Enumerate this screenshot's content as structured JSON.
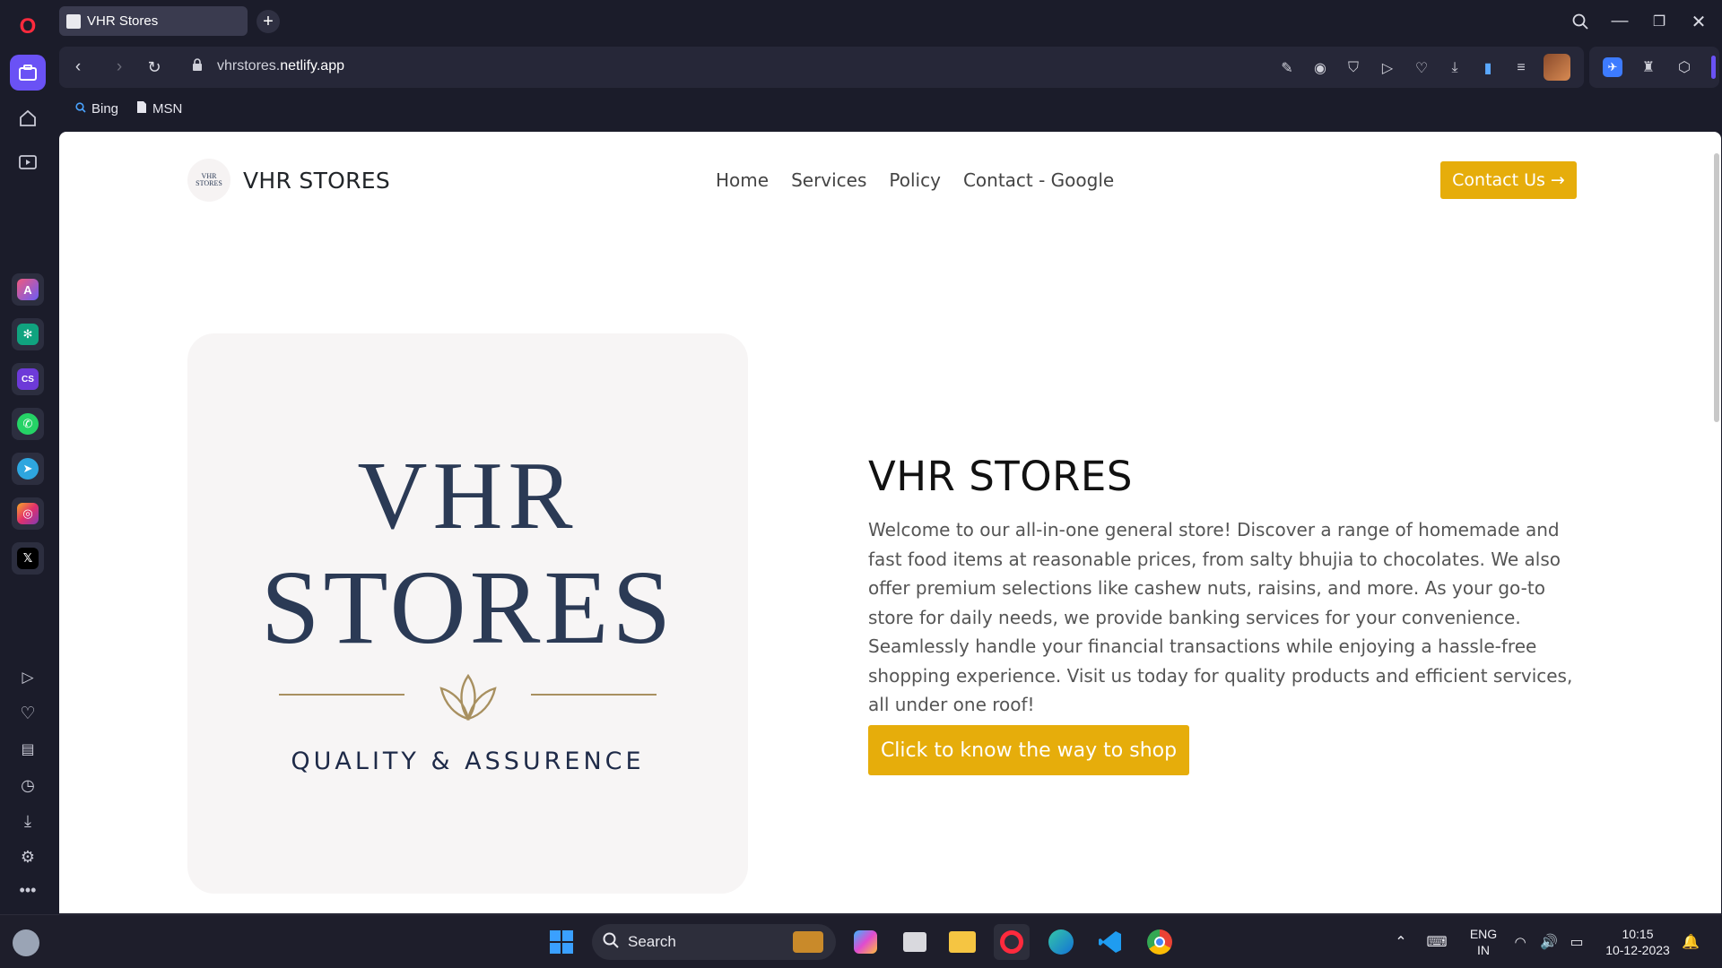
{
  "browser": {
    "tab_title": "VHR Stores",
    "url_prefix": "vhrstores.",
    "url_domain": "netlify.app",
    "bookmarks": [
      {
        "label": "Bing"
      },
      {
        "label": "MSN"
      }
    ]
  },
  "site": {
    "brand_logo_line1": "VHR",
    "brand_logo_line2": "STORES",
    "brand_name": "VHR STORES",
    "nav": [
      "Home",
      "Services",
      "Policy",
      "Contact - Google"
    ],
    "contact_button": "Contact Us",
    "hero_logo": {
      "line1": "VHR",
      "line2": "STORES",
      "tagline": "QUALITY & ASSURENCE"
    },
    "hero_title": "VHR STORES",
    "hero_description": "Welcome to our all-in-one general store! Discover a range of homemade and fast food items at reasonable prices, from salty bhujia to chocolates. We also offer premium selections like cashew nuts, raisins, and more. As your go-to store for daily needs, we provide banking services for your convenience. Seamlessly handle your financial transactions while enjoying a hassle-free shopping experience. Visit us today for quality products and efficient services, all under one roof!",
    "shop_button": "Click to know the way to shop",
    "accent_color": "#e6ad0b"
  },
  "taskbar": {
    "search_label": "Search",
    "language_line1": "ENG",
    "language_line2": "IN",
    "time": "10:15",
    "date": "10-12-2023"
  }
}
